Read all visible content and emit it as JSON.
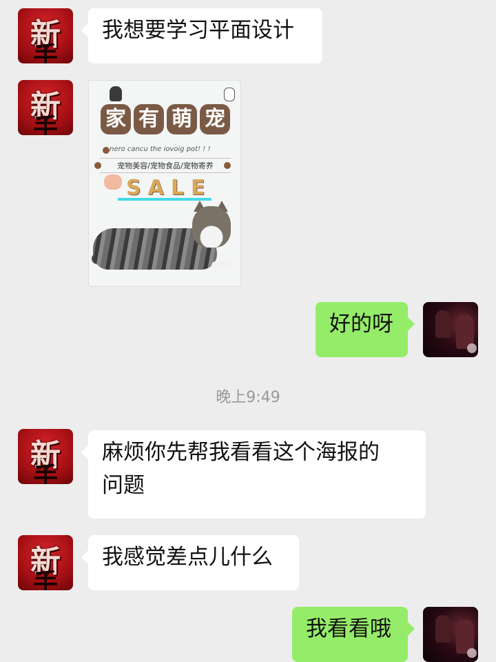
{
  "chat": {
    "messages": [
      {
        "sender": "contact",
        "text": "我想要学习平面设计"
      },
      {
        "sender": "contact",
        "image": {
          "title_chars": [
            "家",
            "有",
            "萌",
            "宠"
          ],
          "subtitle": "nero cancu  the iovoig pot! ! !",
          "tagline": "宠物美容/宠物食品/宠物寄养",
          "sale": "SALE"
        }
      },
      {
        "sender": "me",
        "text": "好的呀"
      },
      {
        "sender": "contact",
        "text_line1": "麻烦你先帮我看看这个海报的",
        "text_line2": "问题"
      },
      {
        "sender": "contact",
        "text": "我感觉差点儿什么"
      },
      {
        "sender": "me",
        "text": "我看看哦"
      }
    ],
    "timestamp": "晚上9:49"
  },
  "contact_avatar": {
    "glyph_top": "新",
    "glyph_bottom": "手"
  },
  "colors": {
    "background": "#ededed",
    "incoming_bubble": "#ffffff",
    "outgoing_bubble": "#95ec69",
    "timestamp": "#999999"
  }
}
